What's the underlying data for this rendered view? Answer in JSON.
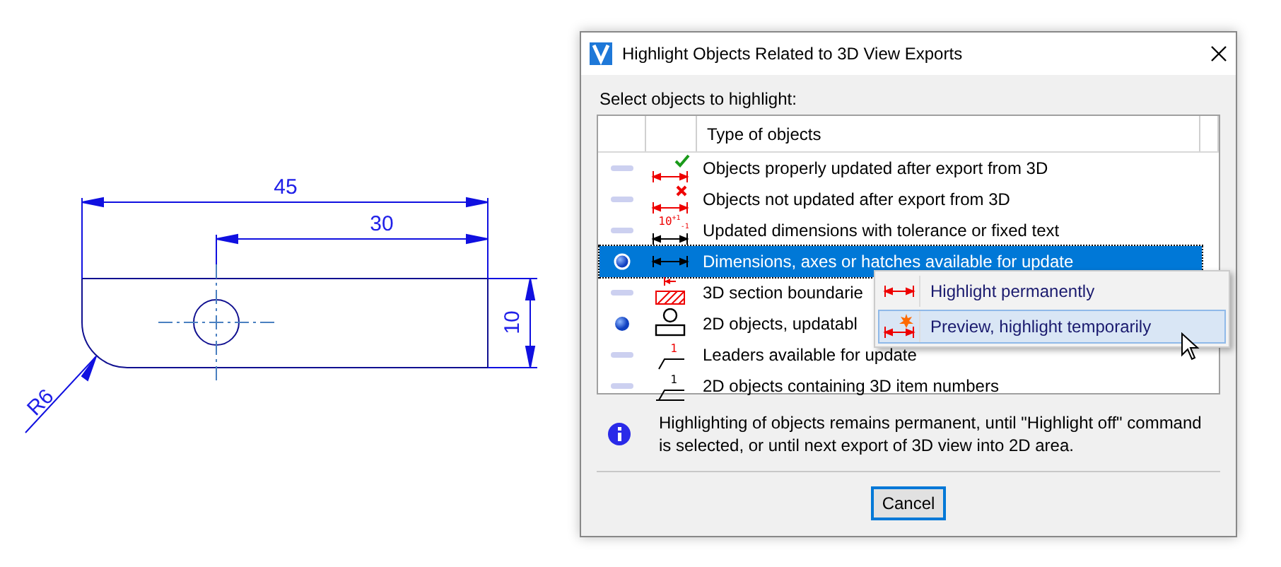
{
  "drawing": {
    "dimension_labels": [
      "45",
      "30",
      "10",
      "R6"
    ]
  },
  "dialog": {
    "title": "Highlight Objects Related to 3D View Exports",
    "prompt": "Select objects to highlight:",
    "table": {
      "columns": [
        "Type of objects"
      ],
      "rows": [
        {
          "marked": false,
          "selected": false,
          "kind": "check",
          "text": "Objects properly updated after export from 3D"
        },
        {
          "marked": false,
          "selected": false,
          "kind": "cross",
          "text": "Objects not updated after export from 3D"
        },
        {
          "marked": false,
          "selected": false,
          "kind": "tolerance",
          "icon_label": "10$^{+1}$$_{-1}$",
          "text": "Updated dimensions with tolerance or fixed text"
        },
        {
          "marked": true,
          "selected": true,
          "kind": "dimension",
          "text": "Dimensions, axes or hatches available for update"
        },
        {
          "marked": false,
          "selected": false,
          "kind": "section",
          "text": "3D section boundarie"
        },
        {
          "marked": true,
          "selected": false,
          "kind": "object2d",
          "text": "2D objects, updatabl"
        },
        {
          "marked": false,
          "selected": false,
          "kind": "leader",
          "icon_label": "1",
          "text": "Leaders available for update"
        },
        {
          "marked": false,
          "selected": false,
          "kind": "itemnumber",
          "icon_label": "1",
          "text": "2D objects containing 3D item numbers"
        }
      ]
    },
    "context_menu": [
      {
        "kind": "dimension",
        "label": "Highlight permanently",
        "selected": false
      },
      {
        "kind": "preview",
        "label": "Preview, highlight temporarily",
        "selected": true
      }
    ],
    "info": "Highlighting of objects remains permanent, until \"Highlight off\" command is selected, or until next export of 3D view into 2D area.",
    "buttons": [
      {
        "label": "Cancel",
        "default": true
      }
    ]
  }
}
